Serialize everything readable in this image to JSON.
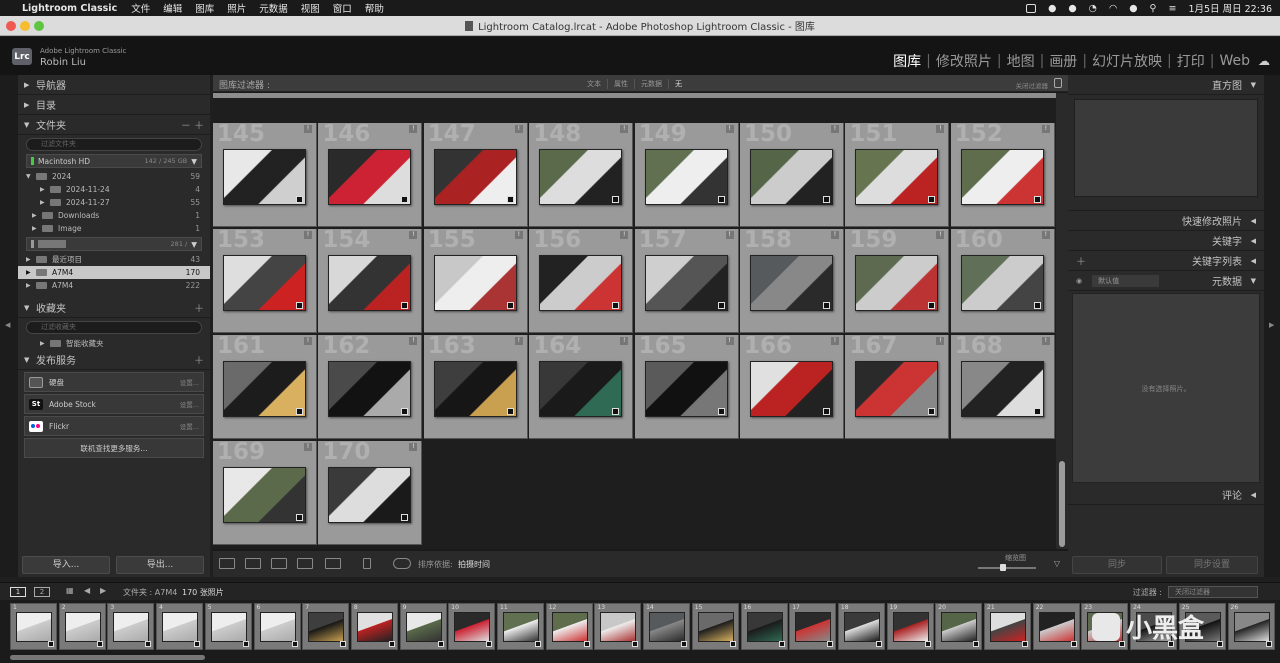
{
  "menubar": {
    "app": "Lightroom Classic",
    "items": [
      "文件",
      "编辑",
      "图库",
      "照片",
      "元数据",
      "视图",
      "窗口",
      "帮助"
    ],
    "clock": "1月5日 周日 22:36"
  },
  "titlebar": {
    "title": "Lightroom Catalog.lrcat - Adobe Photoshop Lightroom Classic - 图库"
  },
  "identity": {
    "logo": "Lrc",
    "product": "Adobe Lightroom Classic",
    "user": "Robin Liu"
  },
  "modules": [
    "图库",
    "修改照片",
    "地图",
    "画册",
    "幻灯片放映",
    "打印",
    "Web"
  ],
  "left_panel": {
    "navigator": "导航器",
    "catalog": "目录",
    "folders": "文件夹",
    "folders_pm": "－ ＋",
    "search_placeholder": "过滤文件夹",
    "volume1": {
      "name": "Macintosh HD",
      "size": "142 / 245 GB"
    },
    "folder_rows": [
      {
        "name": "2024",
        "count": "59"
      },
      {
        "name": "2024-11-24",
        "count": "4"
      },
      {
        "name": "2024-11-27",
        "count": "55"
      },
      {
        "name": "Downloads",
        "count": "1"
      },
      {
        "name": "Image",
        "count": "1"
      }
    ],
    "volume2": {
      "name": "",
      "size": "281 / "
    },
    "folder_rows2": [
      {
        "name": "最近项目",
        "count": "43"
      },
      {
        "name": "A7M4",
        "count": "170"
      },
      {
        "name": "A7M4",
        "count": "222"
      }
    ],
    "collections": "收藏夹",
    "collections_pm": "＋",
    "coll_search": "过滤收藏夹",
    "smart_collections": "智能收藏夹",
    "publish": "发布服务",
    "publish_pm": "＋",
    "services": [
      {
        "name": "硬盘",
        "setup": "设置..."
      },
      {
        "name": "Adobe Stock",
        "setup": "设置..."
      },
      {
        "name": "Flickr",
        "setup": "设置..."
      }
    ],
    "find_more": "联机查找更多服务...",
    "import": "导入...",
    "export": "导出..."
  },
  "filter_bar": {
    "label": "图库过滤器 :",
    "options": [
      "文本",
      "属性",
      "元数据",
      "无"
    ],
    "off": "关闭过滤器"
  },
  "grid_numbers": [
    "145",
    "146",
    "147",
    "148",
    "149",
    "150",
    "151",
    "152",
    "153",
    "154",
    "155",
    "156",
    "157",
    "158",
    "159",
    "160",
    "161",
    "162",
    "163",
    "164",
    "165",
    "166",
    "167",
    "168",
    "169",
    "170"
  ],
  "toolbar": {
    "sort_label": "排序依据:",
    "sort_value": "拍摄时间",
    "thumb_label": "缩览图"
  },
  "right_panel": {
    "histogram": "直方图",
    "quick_develop": "快速修改照片",
    "keywording": "关键字",
    "keyword_list": "关键字列表",
    "metadata": "元数据",
    "metadata_preset": "默认值",
    "no_selection": "没有选择照片。",
    "comments": "评论",
    "sync": "同步",
    "sync_settings": "同步设置"
  },
  "filmstrip": {
    "page1": "1",
    "page2": "2",
    "source": "文件夹 : A7M4",
    "count": "170 张照片",
    "filter_label": "过滤器 :",
    "filter_value": "关闭过滤器",
    "numbers": [
      "1",
      "2",
      "3",
      "4",
      "5",
      "6",
      "7",
      "8",
      "9",
      "10",
      "11",
      "12",
      "13",
      "14",
      "15",
      "16",
      "17",
      "18",
      "19",
      "20",
      "21",
      "22",
      "23",
      "24",
      "25",
      "26"
    ]
  },
  "watermark": "小黑盒"
}
